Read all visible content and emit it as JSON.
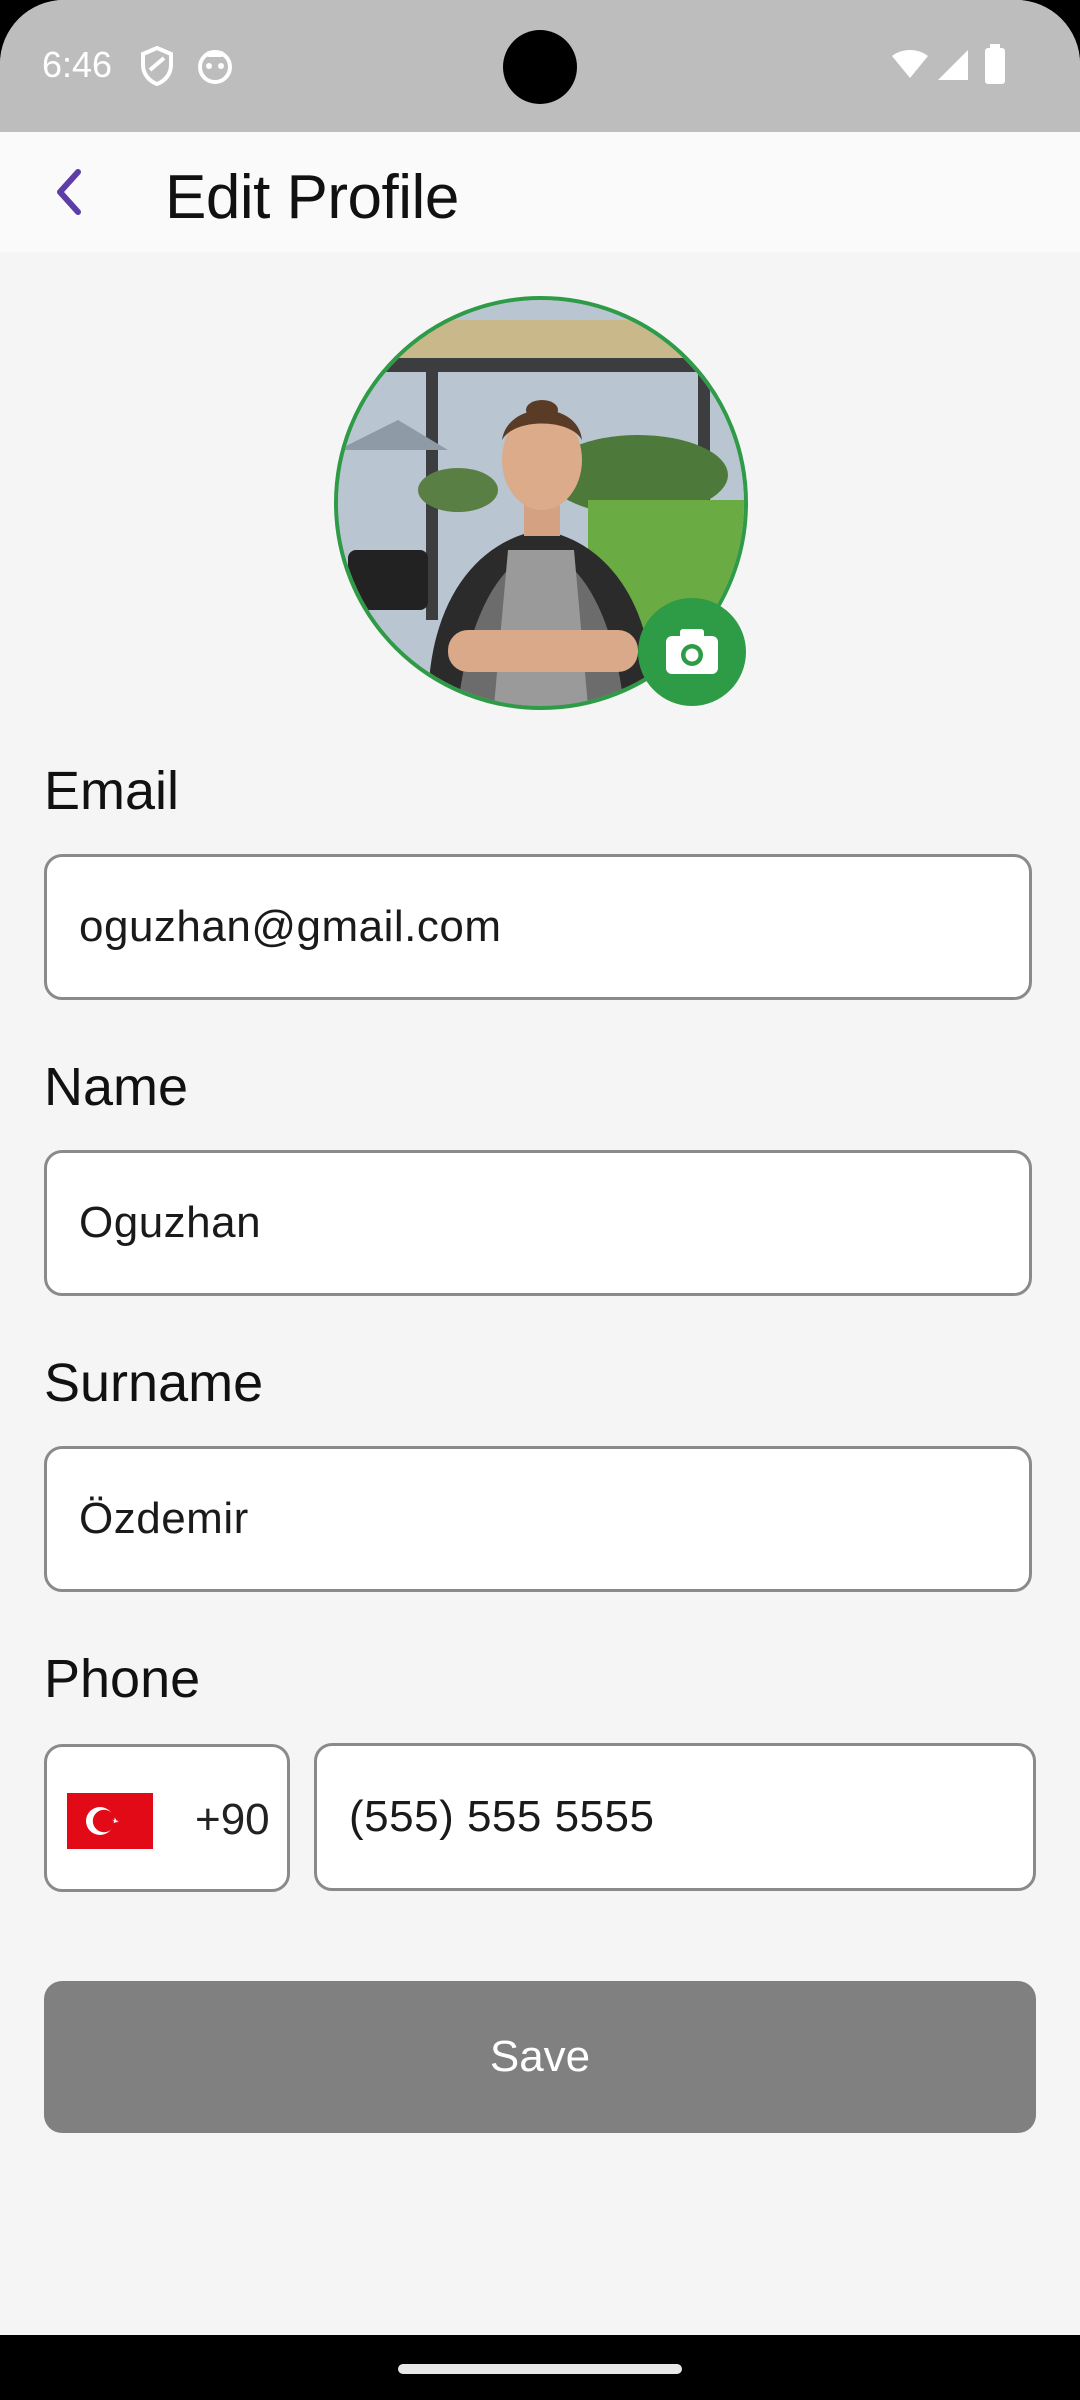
{
  "status_bar": {
    "time": "6:46",
    "bg_color": "#bdbdbd"
  },
  "app_bar": {
    "title": "Edit Profile",
    "back_icon": "chevron-left-icon",
    "accent_color": "#5e3ea6"
  },
  "avatar": {
    "badge_icon": "camera-icon",
    "ring_color": "#2e9b46"
  },
  "fields": {
    "email": {
      "label": "Email",
      "value": "oguzhan@gmail.com"
    },
    "name": {
      "label": "Name",
      "value": "Oguzhan"
    },
    "surname": {
      "label": "Surname",
      "value": "Özdemir"
    },
    "phone": {
      "label": "Phone",
      "country_flag": "turkey-flag-icon",
      "dial_code": "+90",
      "value": "(555) 555 5555"
    }
  },
  "actions": {
    "save_label": "Save",
    "save_color": "#808080"
  }
}
